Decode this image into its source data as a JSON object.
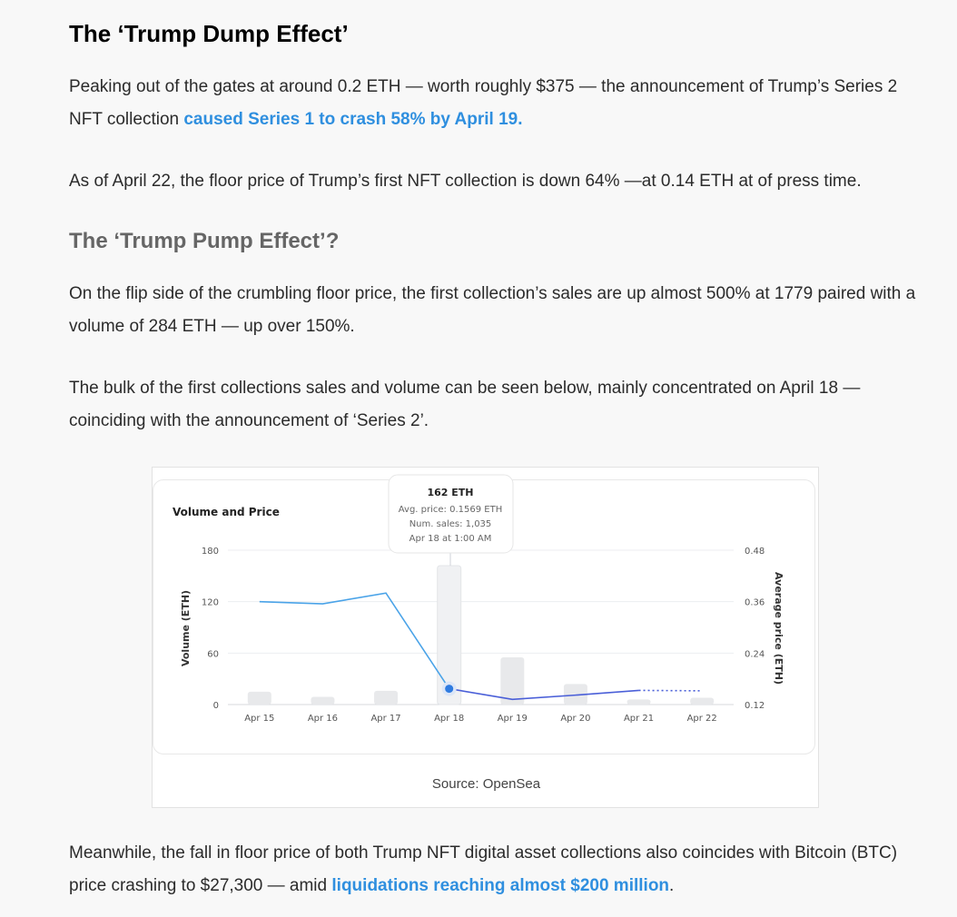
{
  "article": {
    "heading_dump": "The ‘Trump Dump Effect’",
    "p1_text": "Peaking out of the gates at around 0.2 ETH — worth roughly $375 — the announcement of Trump’s Series 2 NFT collection ",
    "p1_link": "caused Series 1 to crash 58% by April 19.",
    "p2": "As of April 22, the floor price of Trump’s first NFT collection is down 64% —at 0.14 ETH at of press time.",
    "heading_pump": "The ‘Trump Pump Effect’?",
    "p3": "On the flip side of the crumbling floor price, the first collection’s sales are up almost 500% at 1779 paired with a volume of 284 ETH — up over 150%.",
    "p4": "The bulk of the first collections sales and volume can be seen below, mainly concentrated on April 18 — coinciding with the announcement of ‘Series 2’.",
    "p5_text": "Meanwhile, the fall in floor price of both Trump NFT digital asset collections also coincides with Bitcoin (BTC) price crashing to $27,300 — amid ",
    "p5_link": "liquidations reaching almost $200 million",
    "p5_end": ".",
    "caption": "Source: OpenSea"
  },
  "colors": {
    "link": "#2f8fdf",
    "line": "#4aa3e8",
    "line_dark": "#4a5fd8",
    "bar": "#e8e9eb",
    "bar_highlight": "#f0f1f3"
  },
  "chart_data": {
    "type": "bar",
    "title": "Volume and Price",
    "categories": [
      "Apr 15",
      "Apr 16",
      "Apr 17",
      "Apr 18",
      "Apr 19",
      "Apr 20",
      "Apr 21",
      "Apr 22"
    ],
    "ylabel": "Volume (ETH)",
    "y2label": "Average price (ETH)",
    "ylim": [
      0,
      180
    ],
    "y_ticks": [
      "180",
      "120",
      "60",
      "0"
    ],
    "y2lim": [
      0.12,
      0.48
    ],
    "y2_ticks": [
      "0.48",
      "0.36",
      "0.24",
      "0.12"
    ],
    "series": [
      {
        "name": "Volume (ETH)",
        "type": "bar",
        "values": [
          15,
          9,
          16,
          162,
          55,
          24,
          6,
          8
        ]
      },
      {
        "name": "Average price (ETH)",
        "type": "line",
        "values": [
          0.36,
          0.355,
          0.38,
          0.1569,
          0.132,
          0.142,
          0.153,
          0.152
        ]
      }
    ],
    "tooltip": {
      "title": "162 ETH",
      "avg_price": "Avg. price: 0.1569 ETH",
      "num_sales": "Num. sales: 1,035",
      "date": "Apr 18 at 1:00 AM"
    },
    "grid": true
  }
}
